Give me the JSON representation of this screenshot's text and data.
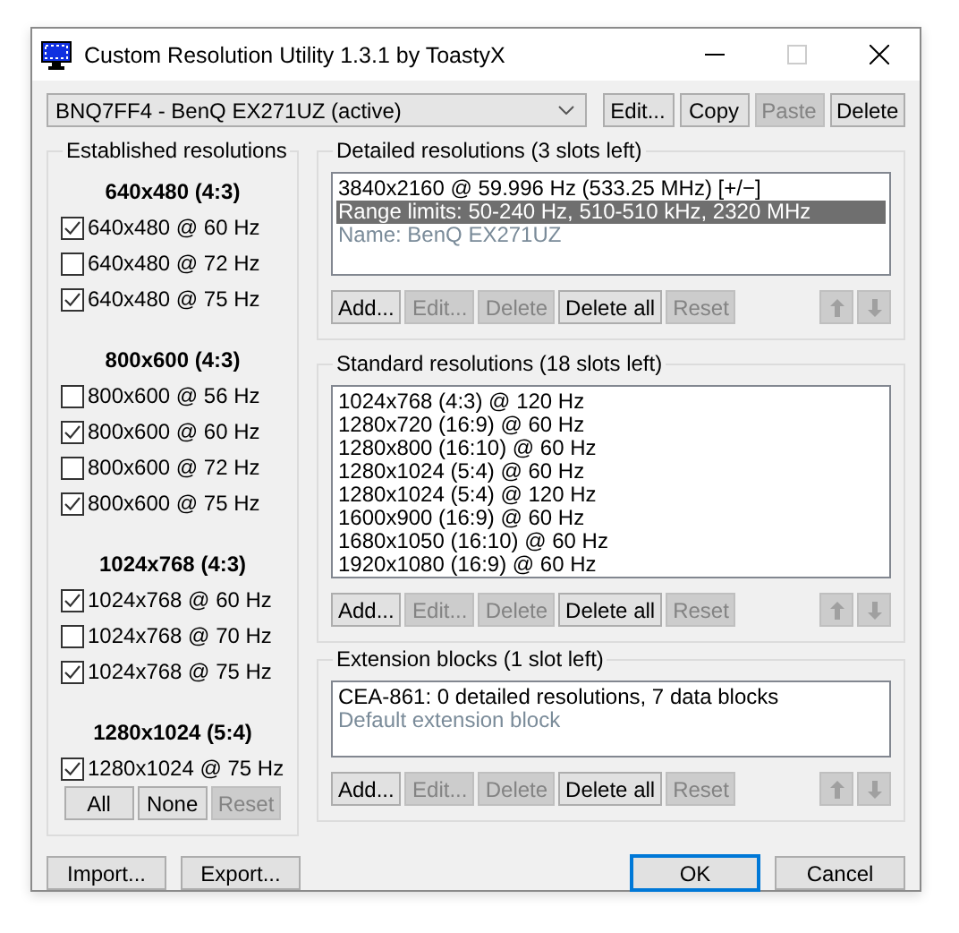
{
  "window": {
    "title": "Custom Resolution Utility 1.3.1 by ToastyX"
  },
  "monitor_select": {
    "value": "BNQ7FF4 - BenQ EX271UZ (active)"
  },
  "top_buttons": [
    {
      "label": "Edit...",
      "disabled": false
    },
    {
      "label": "Copy",
      "disabled": false
    },
    {
      "label": "Paste",
      "disabled": true
    },
    {
      "label": "Delete",
      "disabled": false
    }
  ],
  "established": {
    "title": "Established resolutions",
    "groups": [
      {
        "heading": "640x480 (4:3)",
        "items": [
          {
            "label": "640x480 @ 60 Hz",
            "checked": true
          },
          {
            "label": "640x480 @ 72 Hz",
            "checked": false
          },
          {
            "label": "640x480 @ 75 Hz",
            "checked": true
          }
        ]
      },
      {
        "heading": "800x600 (4:3)",
        "items": [
          {
            "label": "800x600 @ 56 Hz",
            "checked": false
          },
          {
            "label": "800x600 @ 60 Hz",
            "checked": true
          },
          {
            "label": "800x600 @ 72 Hz",
            "checked": false
          },
          {
            "label": "800x600 @ 75 Hz",
            "checked": true
          }
        ]
      },
      {
        "heading": "1024x768 (4:3)",
        "items": [
          {
            "label": "1024x768 @ 60 Hz",
            "checked": true
          },
          {
            "label": "1024x768 @ 70 Hz",
            "checked": false
          },
          {
            "label": "1024x768 @ 75 Hz",
            "checked": true
          }
        ]
      },
      {
        "heading": "1280x1024 (5:4)",
        "items": [
          {
            "label": "1280x1024 @ 75 Hz",
            "checked": true
          }
        ]
      }
    ],
    "buttons": [
      {
        "label": "All",
        "disabled": false
      },
      {
        "label": "None",
        "disabled": false
      },
      {
        "label": "Reset",
        "disabled": true
      }
    ]
  },
  "sections": [
    {
      "title": "Detailed resolutions (3 slots left)",
      "items": [
        {
          "text": "3840x2160 @ 59.996 Hz (533.25 MHz) [+/−]",
          "selected": false,
          "greyed": false
        },
        {
          "text": "Range limits: 50-240 Hz, 510-510 kHz, 2320 MHz",
          "selected": true,
          "greyed": false
        },
        {
          "text": "Name: BenQ EX271UZ",
          "selected": false,
          "greyed": true
        }
      ],
      "buttons": [
        {
          "label": "Add...",
          "disabled": false
        },
        {
          "label": "Edit...",
          "disabled": true
        },
        {
          "label": "Delete",
          "disabled": true
        },
        {
          "label": "Delete all",
          "disabled": false
        },
        {
          "label": "Reset",
          "disabled": true
        }
      ],
      "arrows": [
        {
          "kind": "up",
          "disabled": true
        },
        {
          "kind": "down",
          "disabled": true
        }
      ]
    },
    {
      "title": "Standard resolutions (18 slots left)",
      "items": [
        {
          "text": "1024x768 (4:3) @ 120 Hz",
          "selected": false,
          "greyed": false
        },
        {
          "text": "1280x720 (16:9) @ 60 Hz",
          "selected": false,
          "greyed": false
        },
        {
          "text": "1280x800 (16:10) @ 60 Hz",
          "selected": false,
          "greyed": false
        },
        {
          "text": "1280x1024 (5:4) @ 60 Hz",
          "selected": false,
          "greyed": false
        },
        {
          "text": "1280x1024 (5:4) @ 120 Hz",
          "selected": false,
          "greyed": false
        },
        {
          "text": "1600x900 (16:9) @ 60 Hz",
          "selected": false,
          "greyed": false
        },
        {
          "text": "1680x1050 (16:10) @ 60 Hz",
          "selected": false,
          "greyed": false
        },
        {
          "text": "1920x1080 (16:9) @ 60 Hz",
          "selected": false,
          "greyed": false
        }
      ],
      "buttons": [
        {
          "label": "Add...",
          "disabled": false
        },
        {
          "label": "Edit...",
          "disabled": true
        },
        {
          "label": "Delete",
          "disabled": true
        },
        {
          "label": "Delete all",
          "disabled": false
        },
        {
          "label": "Reset",
          "disabled": true
        }
      ],
      "arrows": [
        {
          "kind": "up",
          "disabled": true
        },
        {
          "kind": "down",
          "disabled": true
        }
      ]
    },
    {
      "title": "Extension blocks (1 slot left)",
      "items": [
        {
          "text": "CEA-861: 0 detailed resolutions, 7 data blocks",
          "selected": false,
          "greyed": false
        },
        {
          "text": "Default extension block",
          "selected": false,
          "greyed": true
        }
      ],
      "buttons": [
        {
          "label": "Add...",
          "disabled": false
        },
        {
          "label": "Edit...",
          "disabled": true
        },
        {
          "label": "Delete",
          "disabled": true
        },
        {
          "label": "Delete all",
          "disabled": false
        },
        {
          "label": "Reset",
          "disabled": true
        }
      ],
      "arrows": [
        {
          "kind": "up",
          "disabled": true
        },
        {
          "kind": "down",
          "disabled": true
        }
      ]
    }
  ],
  "footer": {
    "left": [
      {
        "label": "Import...",
        "default": false
      },
      {
        "label": "Export...",
        "default": false
      }
    ],
    "right": [
      {
        "label": "OK",
        "default": true
      },
      {
        "label": "Cancel",
        "default": false
      }
    ]
  }
}
